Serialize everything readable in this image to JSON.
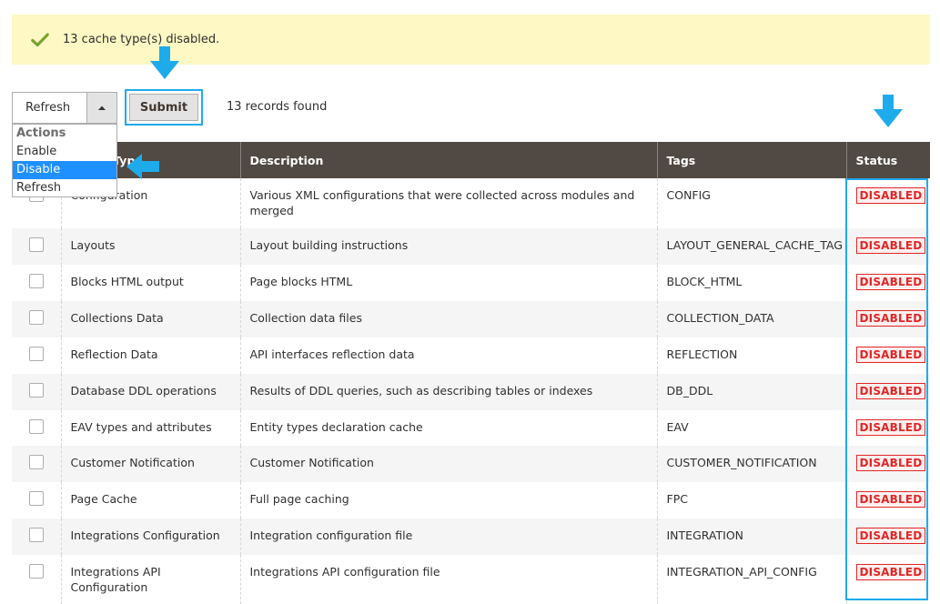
{
  "notice": {
    "message": "13 cache type(s) disabled."
  },
  "toolbar": {
    "action_value": "Refresh",
    "submit_label": "Submit",
    "records": "13 records found"
  },
  "actions_menu": {
    "group_label": "Actions",
    "options": [
      "Enable",
      "Disable",
      "Refresh"
    ],
    "highlighted": "Disable"
  },
  "table": {
    "headers": {
      "type": "Cache Type",
      "description": "Description",
      "tags": "Tags",
      "status": "Status"
    },
    "rows": [
      {
        "type": "Configuration",
        "description": "Various XML configurations that were collected across modules and merged",
        "tags": "CONFIG",
        "status": "DISABLED"
      },
      {
        "type": "Layouts",
        "description": "Layout building instructions",
        "tags": "LAYOUT_GENERAL_CACHE_TAG",
        "status": "DISABLED"
      },
      {
        "type": "Blocks HTML output",
        "description": "Page blocks HTML",
        "tags": "BLOCK_HTML",
        "status": "DISABLED"
      },
      {
        "type": "Collections Data",
        "description": "Collection data files",
        "tags": "COLLECTION_DATA",
        "status": "DISABLED"
      },
      {
        "type": "Reflection Data",
        "description": "API interfaces reflection data",
        "tags": "REFLECTION",
        "status": "DISABLED"
      },
      {
        "type": "Database DDL operations",
        "description": "Results of DDL queries, such as describing tables or indexes",
        "tags": "DB_DDL",
        "status": "DISABLED"
      },
      {
        "type": "EAV types and attributes",
        "description": "Entity types declaration cache",
        "tags": "EAV",
        "status": "DISABLED"
      },
      {
        "type": "Customer Notification",
        "description": "Customer Notification",
        "tags": "CUSTOMER_NOTIFICATION",
        "status": "DISABLED"
      },
      {
        "type": "Page Cache",
        "description": "Full page caching",
        "tags": "FPC",
        "status": "DISABLED"
      },
      {
        "type": "Integrations Configuration",
        "description": "Integration configuration file",
        "tags": "INTEGRATION",
        "status": "DISABLED"
      },
      {
        "type": "Integrations API Configuration",
        "description": "Integrations API configuration file",
        "tags": "INTEGRATION_API_CONFIG",
        "status": "DISABLED"
      }
    ]
  },
  "icons": {
    "notice": "check-icon",
    "select": "triangle-up-icon",
    "annotations": "arrow-icon"
  },
  "colors": {
    "notice_bg": "#fdf8c4",
    "success_check": "#79a22e",
    "header_bg": "#514943",
    "annotation_blue": "#1eabec",
    "disabled_red": "#e22626",
    "menu_highlight": "#1e90ff"
  }
}
